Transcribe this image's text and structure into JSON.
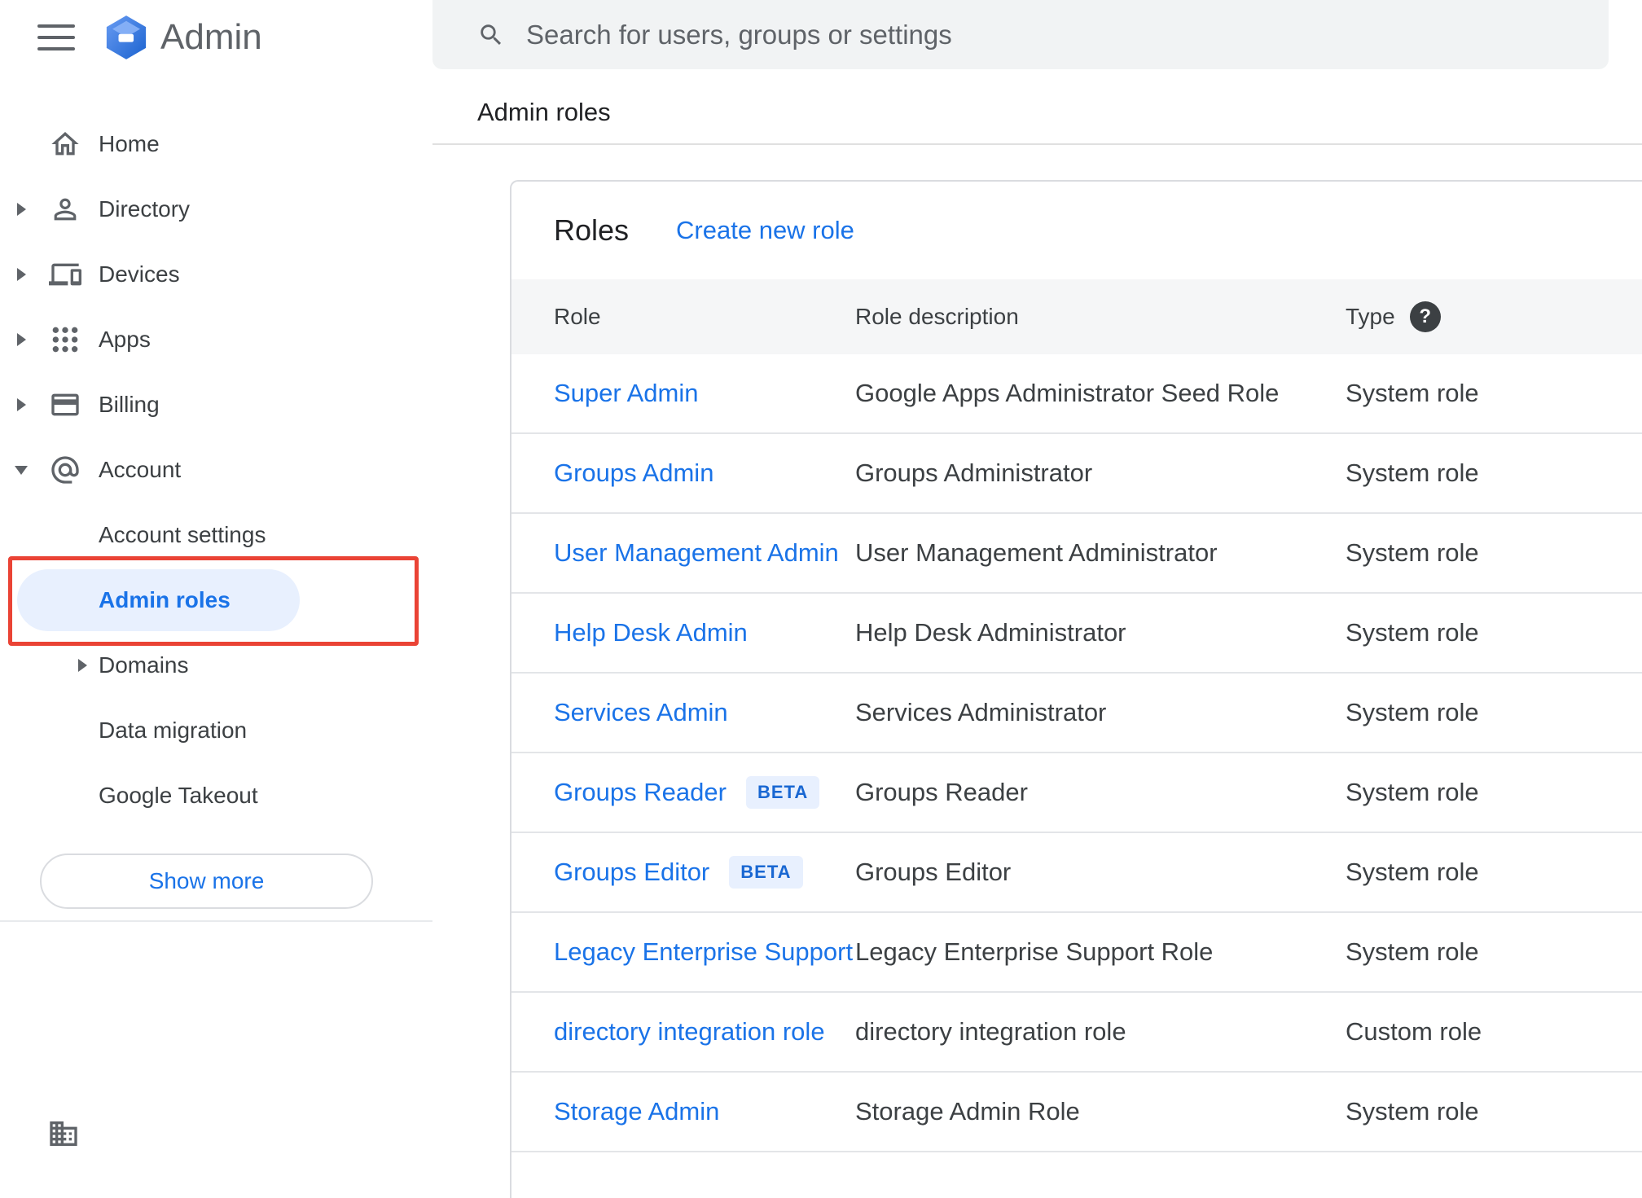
{
  "app": {
    "title": "Admin"
  },
  "topbar": {
    "search_placeholder": "Search for users, groups or settings",
    "breadcrumb": "Admin roles"
  },
  "sidebar": {
    "items": [
      {
        "label": "Home"
      },
      {
        "label": "Directory"
      },
      {
        "label": "Devices"
      },
      {
        "label": "Apps"
      },
      {
        "label": "Billing"
      },
      {
        "label": "Account"
      }
    ],
    "account_subitems": [
      {
        "label": "Account settings"
      },
      {
        "label": "Admin roles"
      },
      {
        "label": "Domains"
      },
      {
        "label": "Data migration"
      },
      {
        "label": "Google Takeout"
      }
    ],
    "show_more": "Show more"
  },
  "roles": {
    "title": "Roles",
    "create_new": "Create new role",
    "columns": {
      "role": "Role",
      "description": "Role description",
      "type": "Type"
    },
    "help_glyph": "?",
    "beta_label": "BETA",
    "rows": [
      {
        "role": "Super Admin",
        "description": "Google Apps Administrator Seed Role",
        "type": "System role"
      },
      {
        "role": "Groups Admin",
        "description": "Groups Administrator",
        "type": "System role"
      },
      {
        "role": "User Management Admin",
        "description": "User Management Administrator",
        "type": "System role"
      },
      {
        "role": "Help Desk Admin",
        "description": "Help Desk Administrator",
        "type": "System role"
      },
      {
        "role": "Services Admin",
        "description": "Services Administrator",
        "type": "System role"
      },
      {
        "role": "Groups Reader",
        "description": "Groups Reader",
        "type": "System role"
      },
      {
        "role": "Groups Editor",
        "description": "Groups Editor",
        "type": "System role"
      },
      {
        "role": "Legacy Enterprise Support",
        "description": "Legacy Enterprise Support Role",
        "type": "System role"
      },
      {
        "role": "directory integration role",
        "description": "directory integration role",
        "type": "Custom role"
      },
      {
        "role": "Storage Admin",
        "description": "Storage Admin Role",
        "type": "System role"
      }
    ]
  },
  "colors": {
    "link_blue": "#1a73e8",
    "active_item_bg": "#e8f0fe",
    "annotation_red": "#ea4335",
    "beta_badge_bg": "#e8f0fe",
    "beta_badge_text": "#1967d2",
    "searchbar_bg": "#f1f3f4",
    "table_header_bg": "#f5f6f7"
  }
}
